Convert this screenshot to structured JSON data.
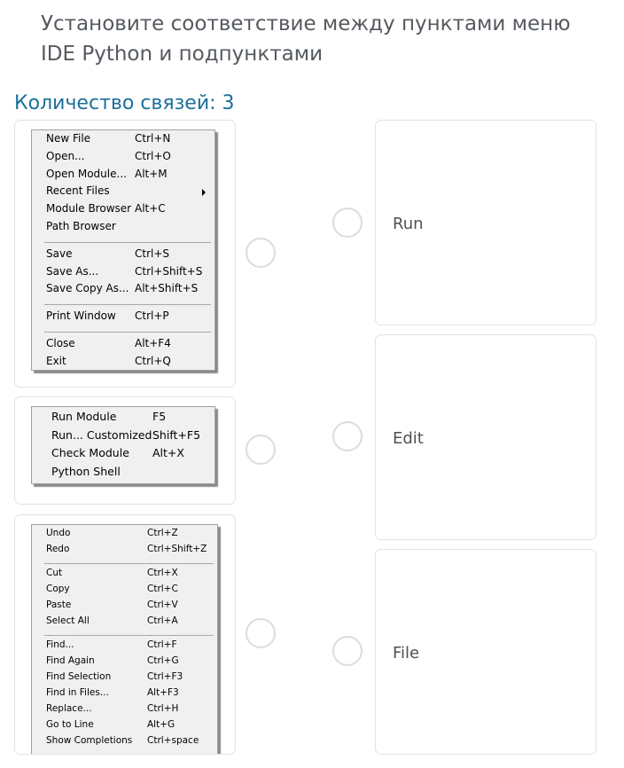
{
  "question": "Установите соответствие между пунктами меню IDE Python и подпунктами",
  "links_count": "Количество связей: 3",
  "left_menus": {
    "file_menu": {
      "groups": [
        [
          {
            "label": "New File",
            "shortcut": "Ctrl+N"
          },
          {
            "label": "Open...",
            "shortcut": "Ctrl+O"
          },
          {
            "label": "Open Module...",
            "shortcut": "Alt+M"
          },
          {
            "label": "Recent Files",
            "shortcut": "",
            "submenu": true
          },
          {
            "label": "Module Browser",
            "shortcut": "Alt+C"
          },
          {
            "label": "Path Browser",
            "shortcut": ""
          }
        ],
        [
          {
            "label": "Save",
            "shortcut": "Ctrl+S"
          },
          {
            "label": "Save As...",
            "shortcut": "Ctrl+Shift+S"
          },
          {
            "label": "Save Copy As...",
            "shortcut": "Alt+Shift+S"
          }
        ],
        [
          {
            "label": "Print Window",
            "shortcut": "Ctrl+P"
          }
        ],
        [
          {
            "label": "Close",
            "shortcut": "Alt+F4"
          },
          {
            "label": "Exit",
            "shortcut": "Ctrl+Q"
          }
        ]
      ]
    },
    "run_menu": {
      "items": [
        {
          "label": "Run Module",
          "shortcut": "F5"
        },
        {
          "label": "Run... Customized",
          "shortcut": "Shift+F5"
        },
        {
          "label": "Check Module",
          "shortcut": "Alt+X"
        },
        {
          "label": "Python Shell",
          "shortcut": ""
        }
      ]
    },
    "edit_menu": {
      "groups": [
        [
          {
            "label": "Undo",
            "shortcut": "Ctrl+Z"
          },
          {
            "label": "Redo",
            "shortcut": "Ctrl+Shift+Z"
          }
        ],
        [
          {
            "label": "Cut",
            "shortcut": "Ctrl+X"
          },
          {
            "label": "Copy",
            "shortcut": "Ctrl+C"
          },
          {
            "label": "Paste",
            "shortcut": "Ctrl+V"
          },
          {
            "label": "Select All",
            "shortcut": "Ctrl+A"
          }
        ],
        [
          {
            "label": "Find...",
            "shortcut": "Ctrl+F"
          },
          {
            "label": "Find Again",
            "shortcut": "Ctrl+G"
          },
          {
            "label": "Find Selection",
            "shortcut": "Ctrl+F3"
          },
          {
            "label": "Find in Files...",
            "shortcut": "Alt+F3"
          },
          {
            "label": "Replace...",
            "shortcut": "Ctrl+H"
          },
          {
            "label": "Go to Line",
            "shortcut": "Alt+G"
          },
          {
            "label": "Show Completions",
            "shortcut": "Ctrl+space"
          }
        ]
      ]
    }
  },
  "right_answers": [
    {
      "label": "Run"
    },
    {
      "label": "Edit"
    },
    {
      "label": "File"
    }
  ],
  "colors": {
    "question_text": "#555a60",
    "links_count_text": "#1d6f99",
    "card_border": "#e2e2e2",
    "radio_border": "#dcdcdc",
    "menu_background": "#f0f0f0"
  }
}
